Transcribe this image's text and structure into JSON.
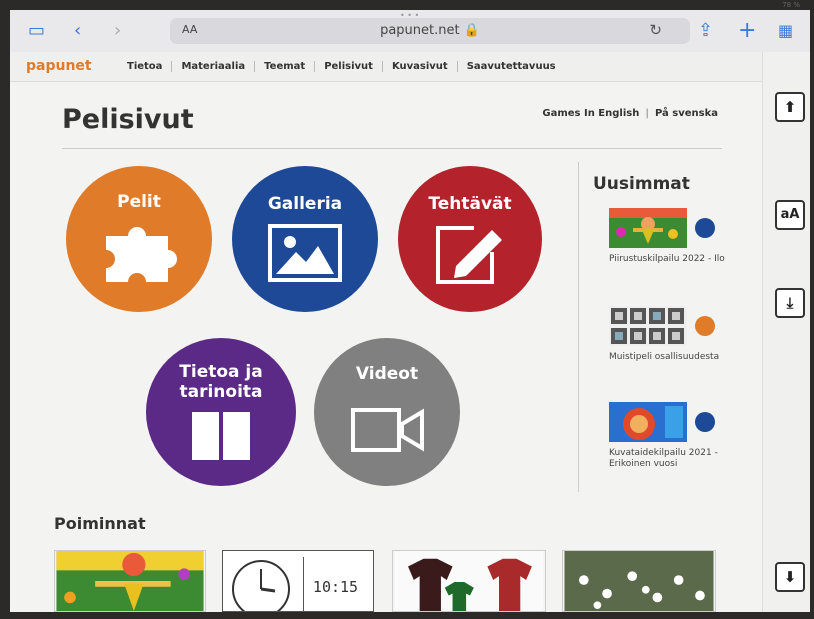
{
  "status": {
    "batt": "78 %"
  },
  "browser": {
    "aa": "AA",
    "url": "papunet.net 🔒"
  },
  "nav": {
    "logo": "papunet",
    "links": [
      "Tietoa",
      "Materiaalia",
      "Teemat",
      "Pelisivut",
      "Kuvasivut",
      "Saavutettavuus"
    ]
  },
  "page": {
    "title": "Pelisivut",
    "lang_en": "Games In English",
    "lang_sep": "|",
    "lang_sv": "På svenska"
  },
  "circles": {
    "pelit": "Pelit",
    "galleria": "Galleria",
    "tehtavat": "Tehtävät",
    "tietoa_1": "Tietoa ja",
    "tietoa_2": "tarinoita",
    "videot": "Videot"
  },
  "sidebar": {
    "heading": "Uusimmat",
    "items": [
      {
        "text": "Piirustuskilpailu 2022 - Ilo"
      },
      {
        "text": "Muistipeli osallisuudesta"
      },
      {
        "text": "Kuvataidekilpailu 2021 - Erikoinen vuosi"
      }
    ]
  },
  "poiminnat": {
    "heading": "Poiminnat",
    "clock_text": "10:15"
  },
  "colors": {
    "orange": "#e07b2a",
    "blue": "#1d4996",
    "red": "#b4232b",
    "purple": "#5b2a86",
    "gray": "#808080"
  },
  "right_buttons": {
    "up": "⬆",
    "text_size": "aA",
    "down": "⬇"
  }
}
